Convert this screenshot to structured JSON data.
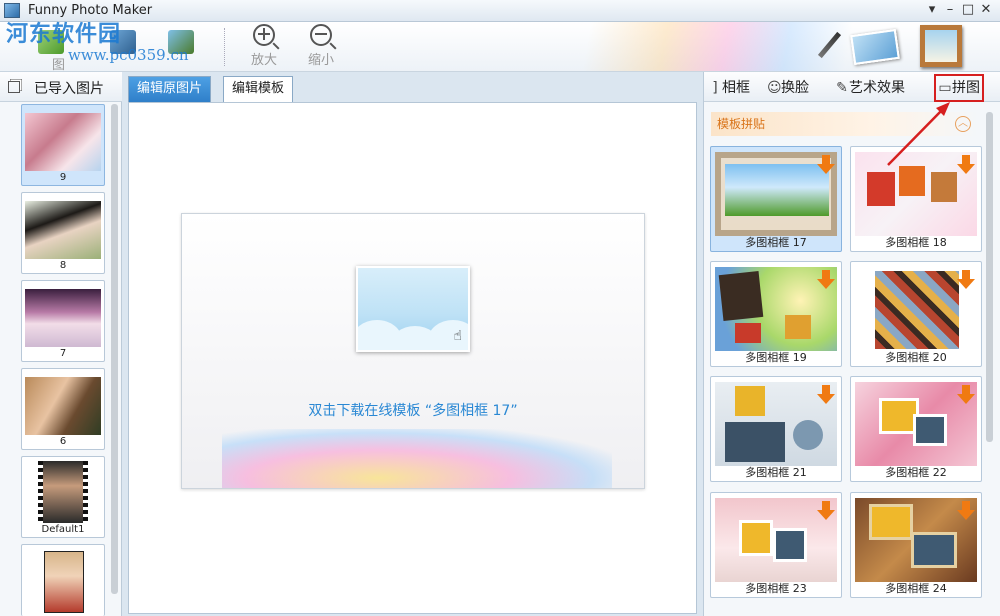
{
  "window": {
    "title": "Funny Photo Maker",
    "controls": [
      "▾",
      "–",
      "□",
      "✕"
    ]
  },
  "watermark": {
    "line1": "河东软件园",
    "line2": "www.pc0359.cn"
  },
  "toolbar": {
    "hidden_label": "图",
    "zoom_in_label": "放大",
    "zoom_out_label": "缩小"
  },
  "left_panel": {
    "header": "已导入图片",
    "thumbnails": [
      {
        "caption": "9",
        "selected": true
      },
      {
        "caption": "8"
      },
      {
        "caption": "7"
      },
      {
        "caption": "6"
      },
      {
        "caption": "Default1"
      },
      {
        "caption": ""
      }
    ]
  },
  "center": {
    "tabs": [
      "编辑原图片",
      "编辑模板"
    ],
    "hint": "双击下载在线模板 “多图相框 17”"
  },
  "right_panel": {
    "tabs": [
      {
        "icon": "frame-icon",
        "glyph": "]",
        "label": "相框"
      },
      {
        "icon": "face-icon",
        "glyph": "☺",
        "label": "换脸"
      },
      {
        "icon": "magic-wand-icon",
        "glyph": "✎",
        "label": "艺术效果"
      },
      {
        "icon": "collage-icon",
        "glyph": "▭",
        "label": "拼图"
      }
    ],
    "section_title": "模板拼贴",
    "section_toggle": "︿",
    "templates": [
      {
        "caption": "多图相框 17",
        "selected": true
      },
      {
        "caption": "多图相框 18"
      },
      {
        "caption": "多图相框 19"
      },
      {
        "caption": "多图相框 20"
      },
      {
        "caption": "多图相框 21"
      },
      {
        "caption": "多图相框 22"
      },
      {
        "caption": "多图相框 23"
      },
      {
        "caption": "多图相框 24"
      }
    ]
  }
}
